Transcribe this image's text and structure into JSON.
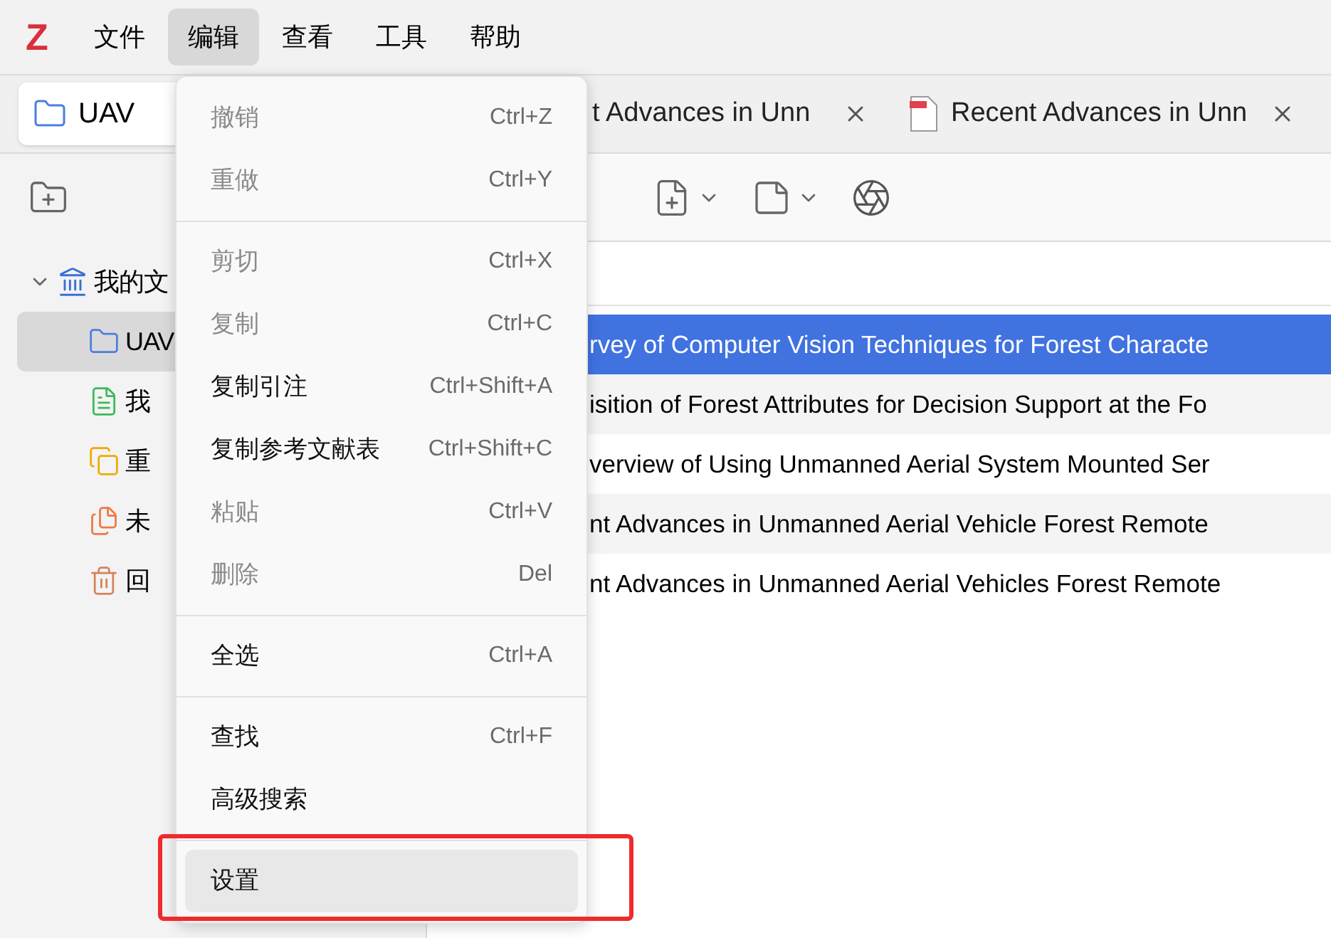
{
  "logo": "Z",
  "menubar": [
    {
      "label": "文件",
      "selected": false
    },
    {
      "label": "编辑",
      "selected": true
    },
    {
      "label": "查看",
      "selected": false
    },
    {
      "label": "工具",
      "selected": false
    },
    {
      "label": "帮助",
      "selected": false
    }
  ],
  "tabs": [
    {
      "label": "UAV",
      "selected": true,
      "kind": "library"
    },
    {
      "label": "t Advances in Unn",
      "selected": false,
      "kind": "reader"
    },
    {
      "label": "Recent Advances in Unn",
      "selected": false,
      "kind": "pdf"
    }
  ],
  "sidebar": {
    "tree": [
      {
        "label": "我的文",
        "kind": "library",
        "expanded": true,
        "selected": false,
        "children": [
          {
            "label": "UAV",
            "kind": "folder",
            "selected": true
          },
          {
            "label": "我",
            "kind": "publications",
            "selected": false
          },
          {
            "label": "重",
            "kind": "duplicates",
            "selected": false
          },
          {
            "label": "未",
            "kind": "unfiled",
            "selected": false
          },
          {
            "label": "回",
            "kind": "trash",
            "selected": false
          }
        ]
      }
    ]
  },
  "items": [
    {
      "title": "rvey of Computer Vision Techniques for Forest Characte",
      "selected": true
    },
    {
      "title": "isition of Forest Attributes for Decision Support at the Fo",
      "selected": false
    },
    {
      "title": "verview of Using Unmanned Aerial System Mounted Ser",
      "selected": false
    },
    {
      "title": "nt Advances in Unmanned Aerial Vehicle Forest Remote",
      "selected": false
    },
    {
      "title": "nt Advances in Unmanned Aerial Vehicles Forest Remote",
      "selected": false
    }
  ],
  "edit_menu": [
    {
      "kind": "item",
      "label": "撤销",
      "shortcut": "Ctrl+Z",
      "disabled": true,
      "selected": false
    },
    {
      "kind": "item",
      "label": "重做",
      "shortcut": "Ctrl+Y",
      "disabled": true,
      "selected": false
    },
    {
      "kind": "separator"
    },
    {
      "kind": "item",
      "label": "剪切",
      "shortcut": "Ctrl+X",
      "disabled": true,
      "selected": false
    },
    {
      "kind": "item",
      "label": "复制",
      "shortcut": "Ctrl+C",
      "disabled": true,
      "selected": false
    },
    {
      "kind": "item",
      "label": "复制引注",
      "shortcut": "Ctrl+Shift+A",
      "disabled": false,
      "selected": false
    },
    {
      "kind": "item",
      "label": "复制参考文献表",
      "shortcut": "Ctrl+Shift+C",
      "disabled": false,
      "selected": false
    },
    {
      "kind": "item",
      "label": "粘贴",
      "shortcut": "Ctrl+V",
      "disabled": true,
      "selected": false
    },
    {
      "kind": "item",
      "label": "删除",
      "shortcut": "Del",
      "disabled": true,
      "selected": false
    },
    {
      "kind": "separator"
    },
    {
      "kind": "item",
      "label": "全选",
      "shortcut": "Ctrl+A",
      "disabled": false,
      "selected": false
    },
    {
      "kind": "separator"
    },
    {
      "kind": "item",
      "label": "查找",
      "shortcut": "Ctrl+F",
      "disabled": false,
      "selected": false
    },
    {
      "kind": "item",
      "label": "高级搜索",
      "disabled": false,
      "selected": false
    },
    {
      "kind": "separator"
    },
    {
      "kind": "item",
      "label": "设置",
      "disabled": false,
      "selected": true,
      "marked": true
    }
  ]
}
